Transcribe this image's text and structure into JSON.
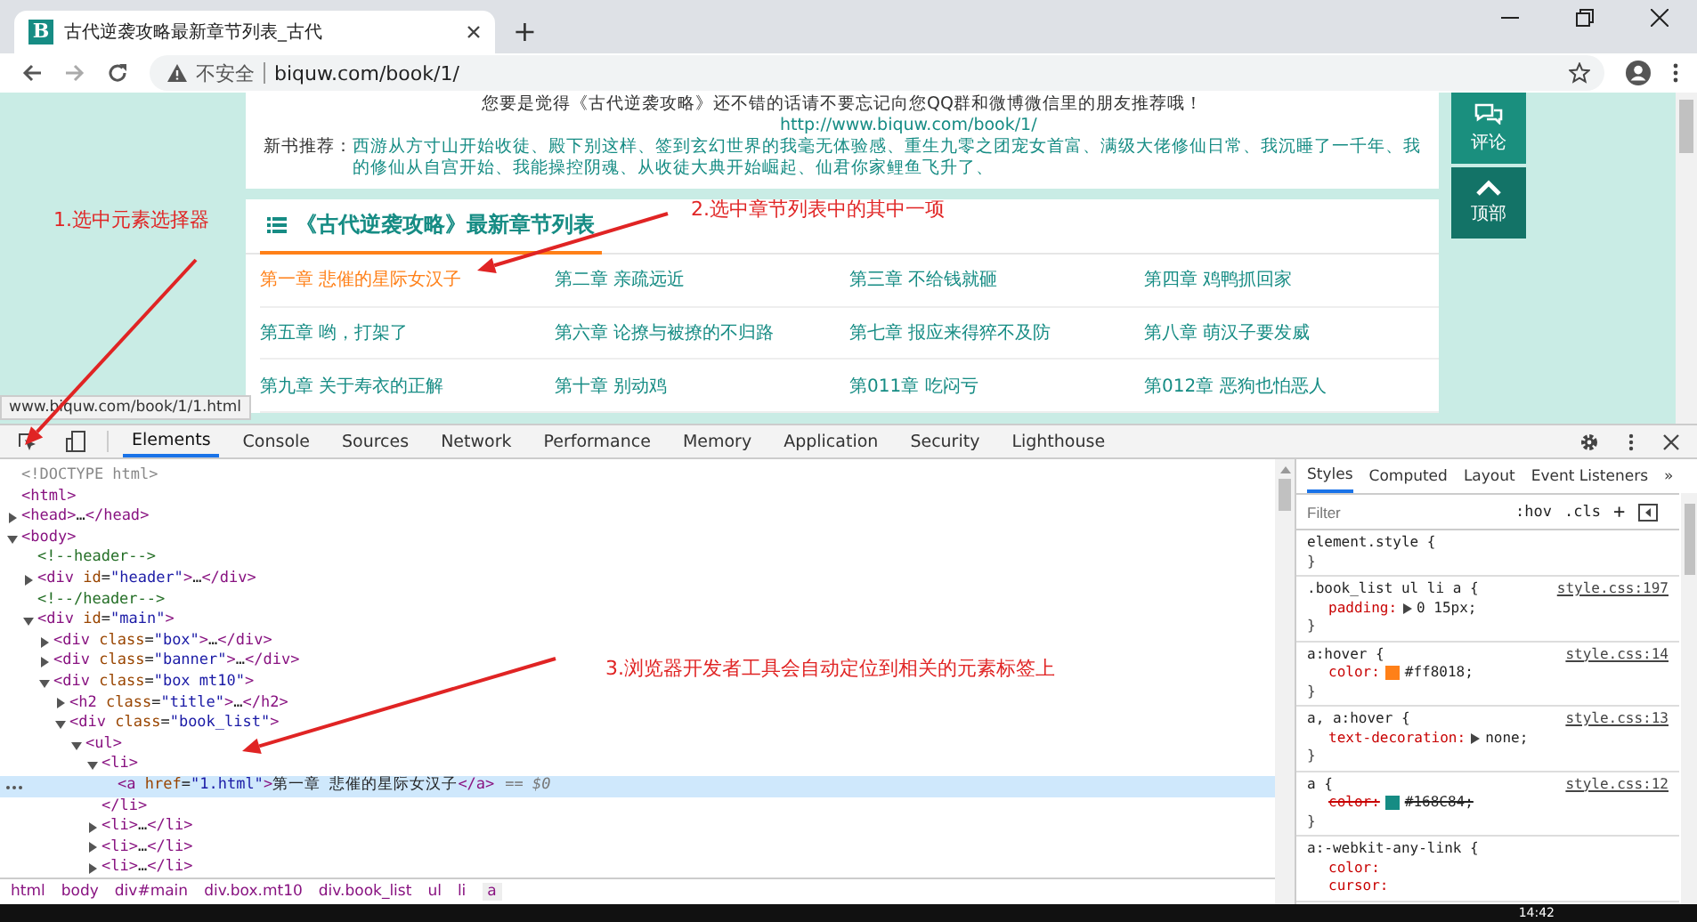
{
  "browser_tab": {
    "favicon": "B",
    "title": "古代逆袭攻略最新章节列表_古代",
    "new_tab": "+"
  },
  "address_bar": {
    "security": "不安全",
    "url": "biquw.com/book/1/"
  },
  "page": {
    "notice": "您要是觉得《古代逆袭攻略》还不错的话请不要忘记向您QQ群和微博微信里的朋友推荐哦！",
    "link": "http://www.biquw.com/book/1/",
    "recommend_label": "新书推荐：",
    "recommend": "西游从方寸山开始收徒、殿下别这样、签到玄幻世界的我毫无体验感、重生九零之团宠女首富、满级大佬修仙日常、我沉睡了一千年、我的修仙从自宫开始、我能操控阴魂、从收徒大典开始崛起、仙君你家鲤鱼飞升了、",
    "side_buttons": [
      {
        "kind": "comment",
        "label": "评论"
      },
      {
        "kind": "top",
        "label": "顶部"
      }
    ],
    "chapter_list": {
      "title": "《古代逆袭攻略》最新章节列表",
      "chapters": [
        {
          "title": "第一章 悲催的星际女汉子",
          "hovered": true
        },
        {
          "title": "第二章 亲疏远近",
          "hovered": false
        },
        {
          "title": "第三章 不给钱就砸",
          "hovered": false
        },
        {
          "title": "第四章 鸡鸭抓回家",
          "hovered": false
        },
        {
          "title": "第五章 哟，打架了",
          "hovered": false
        },
        {
          "title": "第六章 论撩与被撩的不归路",
          "hovered": false
        },
        {
          "title": "第七章 报应来得猝不及防",
          "hovered": false
        },
        {
          "title": "第八章 萌汉子要发威",
          "hovered": false
        },
        {
          "title": "第九章 关于寿衣的正解",
          "hovered": false
        },
        {
          "title": "第十章 别动鸡",
          "hovered": false
        },
        {
          "title": "第011章 吃闷亏",
          "hovered": false
        },
        {
          "title": "第012章 恶狗也怕恶人",
          "hovered": false
        }
      ]
    },
    "status_url": "www.biquw.com/book/1/1.html"
  },
  "annotations": [
    {
      "text": "1.选中元素选择器"
    },
    {
      "text": "2.选中章节列表中的其中一项"
    },
    {
      "text": "3.浏览器开发者工具会自动定位到相关的元素标签上"
    }
  ],
  "devtools": {
    "tabs": [
      {
        "label": "Elements",
        "selected": true
      },
      {
        "label": "Console",
        "selected": false
      },
      {
        "label": "Sources",
        "selected": false
      },
      {
        "label": "Network",
        "selected": false
      },
      {
        "label": "Performance",
        "selected": false
      },
      {
        "label": "Memory",
        "selected": false
      },
      {
        "label": "Application",
        "selected": false
      },
      {
        "label": "Security",
        "selected": false
      },
      {
        "label": "Lighthouse",
        "selected": false
      }
    ],
    "dom_tree": [
      {
        "kind": "doctype",
        "text": "<!DOCTYPE html>",
        "selected": false
      },
      {
        "kind": "tag",
        "text": "<html>",
        "selected": false
      },
      {
        "kind": "node",
        "text": "<head>…</head>",
        "expanded": false,
        "selected": false
      },
      {
        "kind": "node",
        "text": "<body>",
        "expanded": true,
        "selected": false,
        "children": [
          {
            "kind": "comment",
            "text": "<!--header-->",
            "selected": false
          },
          {
            "kind": "node",
            "text": "<div id=\"header\">…</div>",
            "expanded": false,
            "selected": false
          },
          {
            "kind": "comment",
            "text": "<!--/header-->",
            "selected": false
          },
          {
            "kind": "node",
            "text": "<div id=\"main\">",
            "expanded": true,
            "selected": false,
            "children": [
              {
                "kind": "node",
                "text": "<div class=\"box\">…</div>",
                "expanded": false,
                "selected": false
              },
              {
                "kind": "node",
                "text": "<div class=\"banner\">…</div>",
                "expanded": false,
                "selected": false
              },
              {
                "kind": "node",
                "text": "<div class=\"box mt10\">",
                "expanded": true,
                "selected": false,
                "children": [
                  {
                    "kind": "node",
                    "text": "<h2 class=\"title\">…</h2>",
                    "expanded": false,
                    "selected": false
                  },
                  {
                    "kind": "node",
                    "text": "<div class=\"book_list\">",
                    "expanded": true,
                    "selected": false,
                    "children": [
                      {
                        "kind": "node",
                        "text": "<ul>",
                        "expanded": true,
                        "selected": false,
                        "children": [
                          {
                            "kind": "node",
                            "text": "<li>",
                            "expanded": true,
                            "selected": false,
                            "close": "</li>",
                            "children": [
                              {
                                "kind": "tag",
                                "text": "<a href=\"1.html\">第一章  悲催的星际女汉子</a>",
                                "suffix": "== $0",
                                "selected": true
                              }
                            ]
                          },
                          {
                            "kind": "node",
                            "text": "<li>…</li>",
                            "expanded": false,
                            "selected": false
                          },
                          {
                            "kind": "node",
                            "text": "<li>…</li>",
                            "expanded": false,
                            "selected": false
                          },
                          {
                            "kind": "node",
                            "text": "<li>…</li>",
                            "expanded": false,
                            "selected": false
                          }
                        ]
                      }
                    ]
                  }
                ]
              }
            ]
          }
        ]
      }
    ],
    "breadcrumbs": [
      {
        "label": "html",
        "selected": false
      },
      {
        "label": "body",
        "selected": false
      },
      {
        "label": "div#main",
        "selected": false
      },
      {
        "label": "div.box.mt10",
        "selected": false
      },
      {
        "label": "div.book_list",
        "selected": false
      },
      {
        "label": "ul",
        "selected": false
      },
      {
        "label": "li",
        "selected": false
      },
      {
        "label": "a",
        "selected": true
      }
    ],
    "styles_pane": {
      "tabs": [
        {
          "label": "Styles",
          "selected": true
        },
        {
          "label": "Computed",
          "selected": false
        },
        {
          "label": "Layout",
          "selected": false
        },
        {
          "label": "Event Listeners",
          "selected": false
        }
      ],
      "more": "»",
      "filter": {
        "placeholder": "Filter"
      },
      "hov": ":hov",
      "cls": ".cls",
      "add": "+",
      "rules": [
        {
          "selector": "element.style {",
          "close": "}"
        },
        {
          "selector": ".book_list ul li a {",
          "source": "style.css:197",
          "close": "}",
          "props": [
            {
              "name": "padding:",
              "value": "0 15px;",
              "expandable": true,
              "struck": false
            }
          ]
        },
        {
          "selector": "a:hover {",
          "source": "style.css:14",
          "close": "}",
          "props": [
            {
              "name": "color:",
              "value": "#ff8018;",
              "color": "#ff8018",
              "expandable": false,
              "struck": false
            }
          ]
        },
        {
          "selector": "a, a:hover {",
          "source": "style.css:13",
          "close": "}",
          "props": [
            {
              "name": "text-decoration:",
              "value": "none;",
              "expandable": true,
              "struck": false
            }
          ]
        },
        {
          "selector": "a {",
          "source": "style.css:12",
          "close": "}",
          "props": [
            {
              "name": "color:",
              "value": "#168C84;",
              "color": "#168c84",
              "expandable": false,
              "struck": true
            }
          ]
        },
        {
          "selector": "a:-webkit-any-link {",
          "props": [
            {
              "name": "color:",
              "expandable": false,
              "struck": false
            },
            {
              "name": "cursor:",
              "expandable": false,
              "struck": false
            }
          ]
        }
      ]
    }
  },
  "taskbar": {
    "time": "14:42"
  }
}
